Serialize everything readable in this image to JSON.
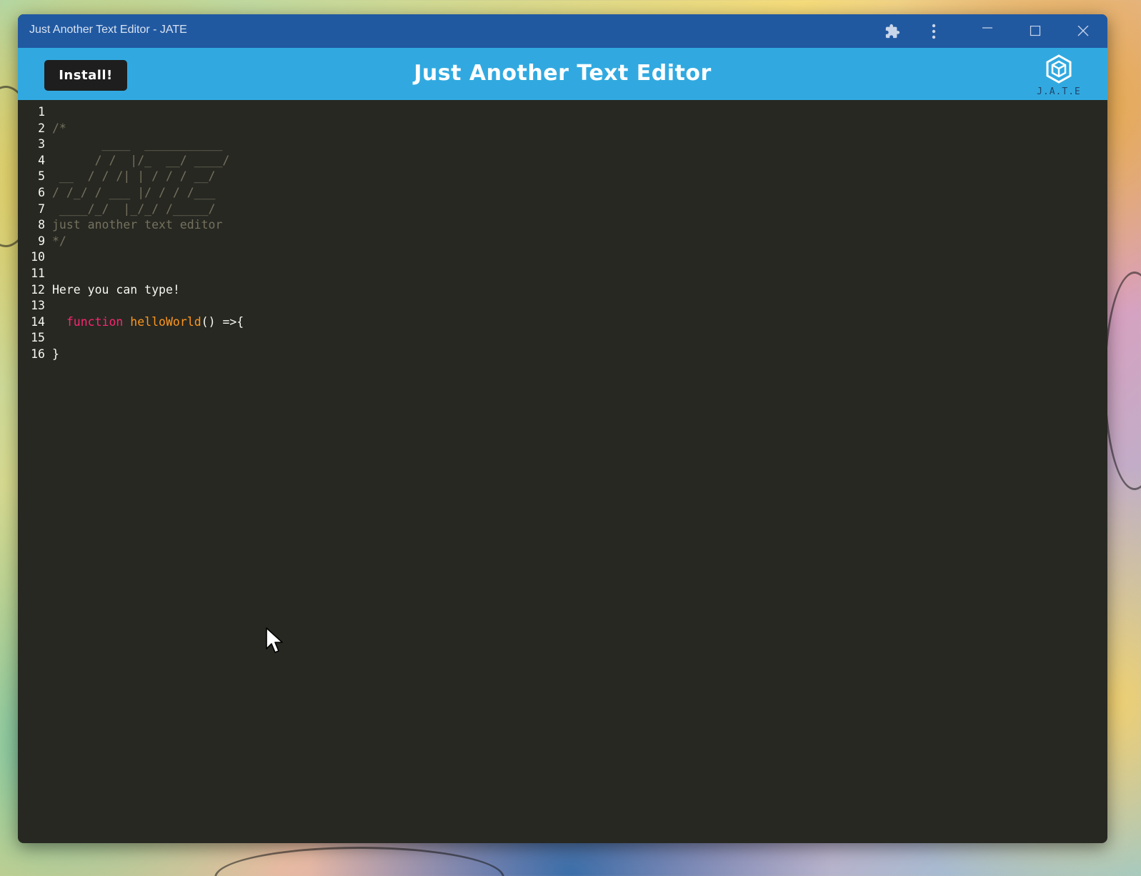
{
  "window": {
    "title": "Just Another Text Editor - JATE",
    "controls": {
      "extensions_icon": "puzzle-icon",
      "menu_icon": "more-vert-icon",
      "minimize_icon": "minimize-icon",
      "maximize_icon": "maximize-icon",
      "close_icon": "close-icon"
    }
  },
  "header": {
    "install_label": "Install!",
    "title": "Just Another Text Editor",
    "logo_text": "J.A.T.E",
    "background": "#31a9e0"
  },
  "editor": {
    "background": "#272822",
    "lines": [
      {
        "num": "1",
        "text": "",
        "type": "plain"
      },
      {
        "num": "2",
        "text": "/*",
        "type": "comment"
      },
      {
        "num": "3",
        "text": "       ____  ___________",
        "type": "comment"
      },
      {
        "num": "4",
        "text": "      / /  |/_  __/ ____/",
        "type": "comment"
      },
      {
        "num": "5",
        "text": " __  / / /| | / / / __/",
        "type": "comment"
      },
      {
        "num": "6",
        "text": "/ /_/ / ___ |/ / / /___",
        "type": "comment"
      },
      {
        "num": "7",
        "text": " ____/_/  |_/_/ /_____/",
        "type": "comment"
      },
      {
        "num": "8",
        "text": "just another text editor",
        "type": "comment"
      },
      {
        "num": "9",
        "text": "*/",
        "type": "comment"
      },
      {
        "num": "10",
        "text": "",
        "type": "plain"
      },
      {
        "num": "11",
        "text": "",
        "type": "plain"
      },
      {
        "num": "12",
        "text": "Here you can type!",
        "type": "plain"
      },
      {
        "num": "13",
        "text": "",
        "type": "plain"
      },
      {
        "num": "14",
        "indent": "  ",
        "keyword": "function",
        "def": "helloWorld",
        "rest": "() =>{",
        "type": "code"
      },
      {
        "num": "15",
        "text": "",
        "type": "plain"
      },
      {
        "num": "16",
        "text": "}",
        "type": "plain"
      }
    ]
  }
}
